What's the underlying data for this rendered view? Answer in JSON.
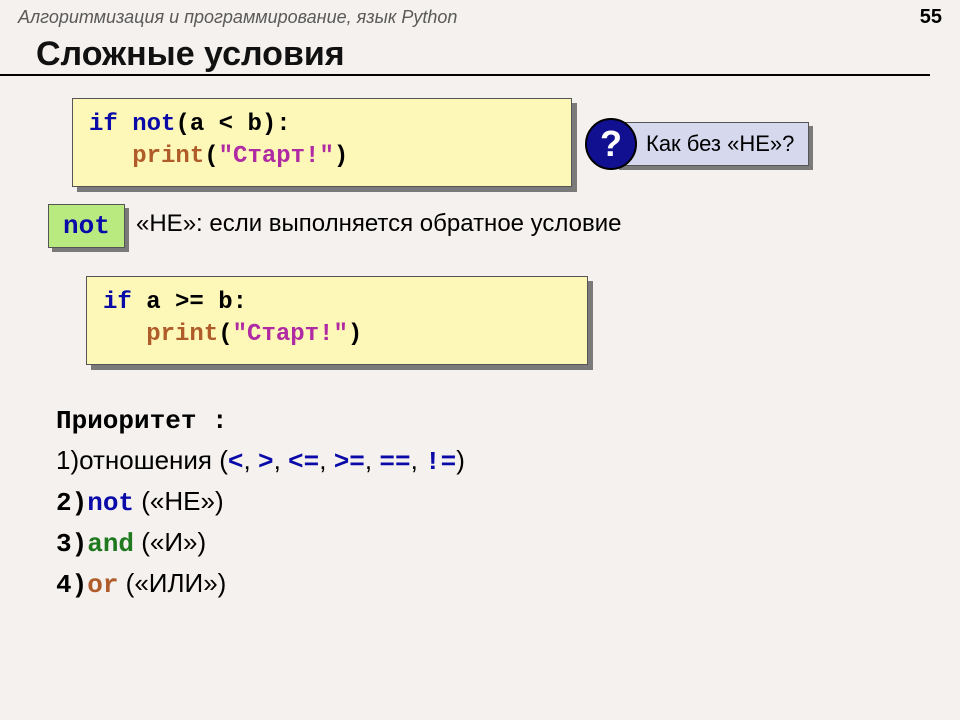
{
  "header": {
    "course": "Алгоритмизация и программирование, язык Python",
    "page": "55"
  },
  "title": "Сложные условия",
  "code1": {
    "kw_if": "if",
    "kw_not": "not",
    "rest1": "(a < b):",
    "indent": "   ",
    "fn": "print",
    "paren_open": "(",
    "str": "\"Старт!\"",
    "paren_close": ")"
  },
  "question": {
    "mark": "?",
    "text": " Как без «НЕ»?"
  },
  "not_block": {
    "badge": "not",
    "desc": "«НЕ»: если выполняется обратное условие"
  },
  "code2": {
    "kw_if": "if",
    "cond": " a >= b:",
    "indent": "   ",
    "fn": "print",
    "paren_open": "(",
    "str": "\"Старт!\"",
    "paren_close": ")"
  },
  "priority": {
    "title": "Приоритет :",
    "l1a": "1)отношения (",
    "op_lt": "<",
    "sep1": ", ",
    "op_gt": ">",
    "sep2": ", ",
    "op_le": "<=",
    "sep3": ", ",
    "op_ge": ">=",
    "sep4": ", ",
    "op_eq": "==",
    "sep5": ", ",
    "op_ne": "!=",
    "l1b": ")",
    "l2n": "2)",
    "l2kw": "not",
    "l2d": " («НЕ»)",
    "l3n": "3)",
    "l3kw": "and",
    "l3d": " («И»)",
    "l4n": "4)",
    "l4kw": "or",
    "l4d": " («ИЛИ»)"
  }
}
